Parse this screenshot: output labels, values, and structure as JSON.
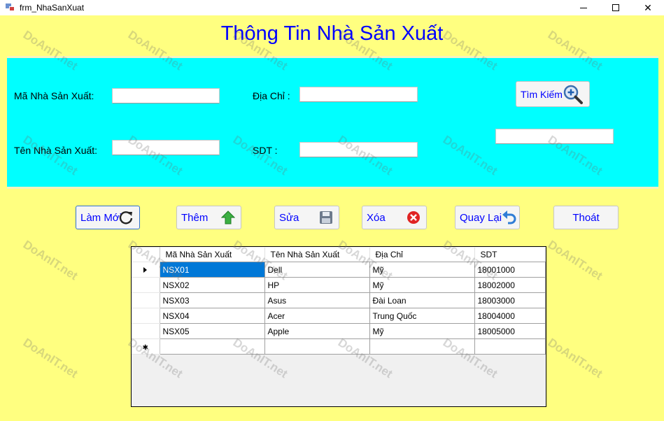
{
  "window": {
    "title": "frm_NhaSanXuat"
  },
  "form": {
    "title": "Thông Tin Nhà Sản Xuất"
  },
  "fields": {
    "ma_label": "Mã Nhà Sản Xuất:",
    "ten_label": "Tên Nhà Sản Xuất:",
    "diachi_label": "Địa Chỉ :",
    "sdt_label": "SDT :",
    "ma_value": "",
    "ten_value": "",
    "diachi_value": "",
    "sdt_value": "",
    "search_value": ""
  },
  "buttons": {
    "search": "Tìm Kiếm",
    "refresh": "Làm Mới",
    "add": "Thêm",
    "edit": "Sửa",
    "delete": "Xóa",
    "back": "Quay Lại",
    "exit": "Thoát"
  },
  "icons": {
    "search": "magnifier-plus-icon",
    "refresh": "refresh-icon",
    "add": "green-arrow-up-icon",
    "edit": "floppy-disk-icon",
    "delete": "red-x-circle-icon",
    "back": "undo-arrow-icon"
  },
  "table": {
    "columns": [
      "Mã Nhà Sản Xuất",
      "Tên Nhà Sản Xuất",
      "Địa Chỉ",
      "SDT"
    ],
    "rows": [
      [
        "NSX01",
        "Dell",
        "Mỹ",
        "18001000"
      ],
      [
        "NSX02",
        "HP",
        "Mỹ",
        "18002000"
      ],
      [
        "NSX03",
        "Asus",
        "Đài Loan",
        "18003000"
      ],
      [
        "NSX04",
        "Acer",
        "Trung Quốc",
        "18004000"
      ],
      [
        "NSX05",
        "Apple",
        "Mỹ",
        "18005000"
      ]
    ],
    "selected_row": 0
  },
  "watermark": "DoAnIT.net",
  "colors": {
    "background": "#ffff80",
    "panel": "#00ffff",
    "title": "#0000ff",
    "selection": "#0078d7"
  }
}
